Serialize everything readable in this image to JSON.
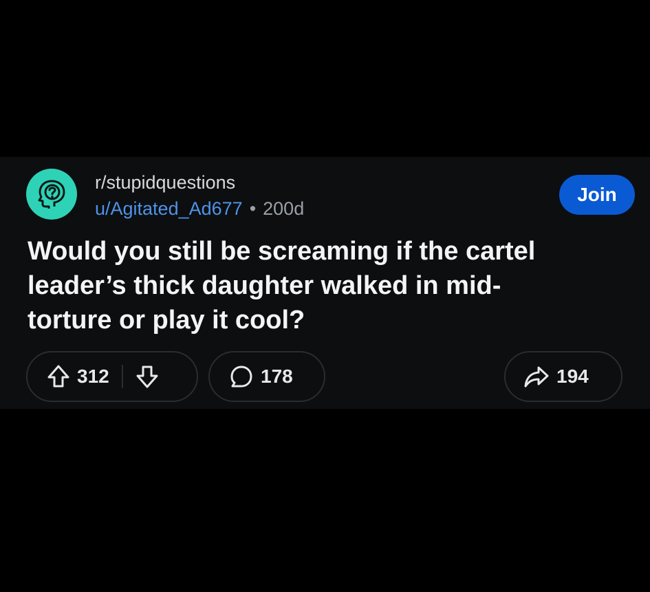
{
  "post": {
    "subreddit": "r/stupidquestions",
    "username": "u/Agitated_Ad677",
    "separator": "•",
    "age": "200d",
    "join_label": "Join",
    "title": "Would you still be screaming if the cartel leader’s thick daughter walked in mid-torture or play it cool?",
    "upvotes": "312",
    "comments": "178",
    "shares": "194"
  },
  "colors": {
    "background": "#000000",
    "card": "#0c0e10",
    "avatar": "#2ed3b7",
    "join_button": "#0a5ad3",
    "username": "#4f93e8"
  },
  "icons": {
    "avatar": "subreddit-avatar-icon",
    "upvote": "upvote-arrow-icon",
    "downvote": "downvote-arrow-icon",
    "comment": "comment-bubble-icon",
    "share": "share-arrow-icon"
  }
}
